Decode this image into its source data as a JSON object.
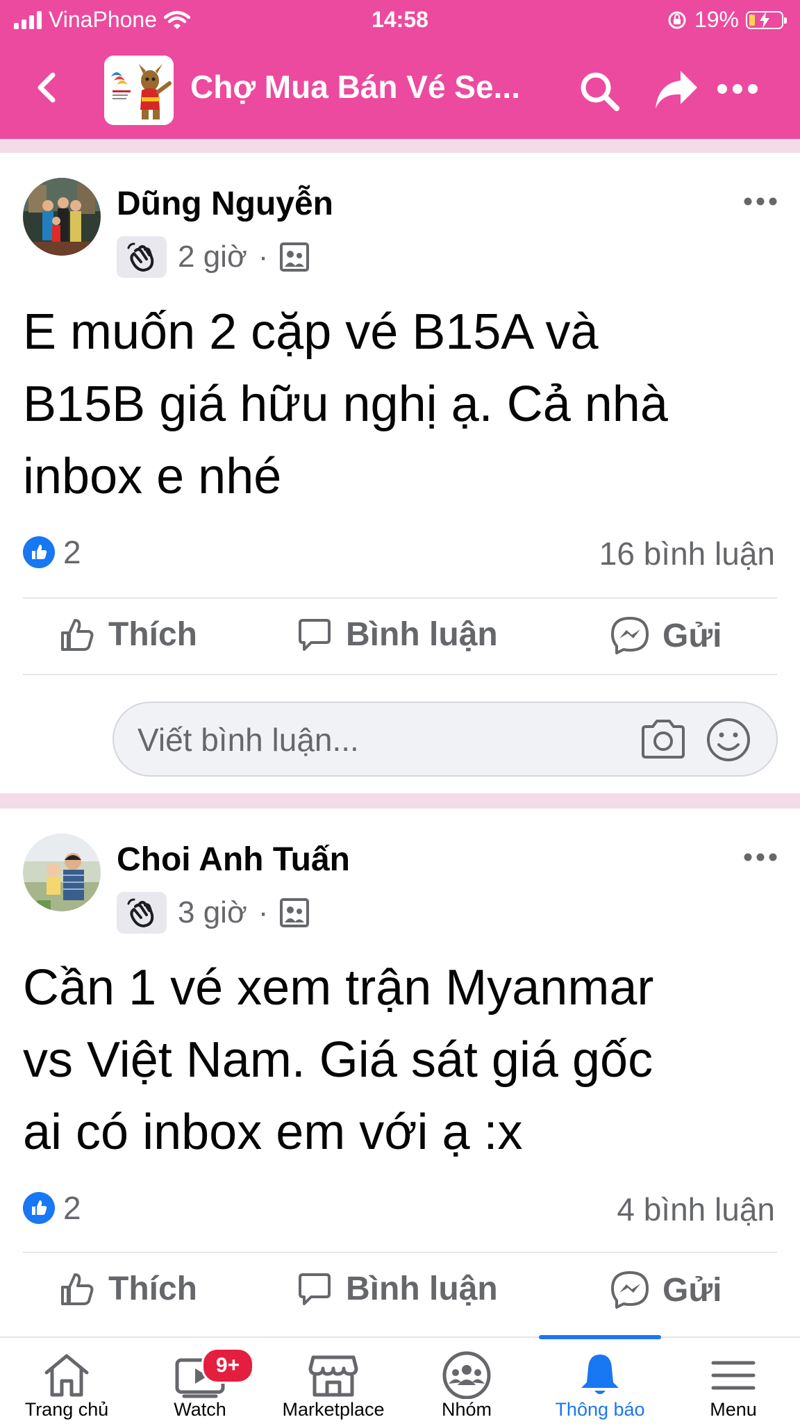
{
  "status_bar": {
    "carrier": "VinaPhone",
    "time": "14:58",
    "battery": "19%",
    "battery_level": 0.19
  },
  "header": {
    "title": "Chợ Mua Bán Vé Se...",
    "back_icon": "chevron-left-icon",
    "search_icon": "search-icon",
    "share_icon": "share-icon",
    "more_icon": "more-horizontal-icon"
  },
  "posts": [
    {
      "author": "Dũng Nguyễn",
      "time": "2 giờ",
      "separator": "·",
      "text": "E muốn 2 cặp vé B15A và\nB15B giá hữu nghị ạ. Cả nhà\ninbox e nhé",
      "likes": "2",
      "comments": "16 bình luận",
      "actions": {
        "like": "Thích",
        "comment": "Bình luận",
        "send": "Gửi"
      },
      "comment_placeholder": "Viết bình luận..."
    },
    {
      "author": "Choi Anh Tuấn",
      "time": "3 giờ",
      "separator": "·",
      "text": "Cần 1 vé xem trận Myanmar\nvs Việt Nam. Giá sát giá gốc\nai có inbox em với ạ :x",
      "likes": "2",
      "comments": "4 bình luận",
      "actions": {
        "like": "Thích",
        "comment": "Bình luận",
        "send": "Gửi"
      }
    }
  ],
  "bottom_nav": {
    "items": [
      {
        "label": "Trang chủ",
        "icon": "home-icon"
      },
      {
        "label": "Watch",
        "icon": "video-icon",
        "badge": "9+"
      },
      {
        "label": "Marketplace",
        "icon": "shop-icon"
      },
      {
        "label": "Nhóm",
        "icon": "groups-icon"
      },
      {
        "label": "Thông báo",
        "icon": "bell-icon",
        "active": true
      },
      {
        "label": "Menu",
        "icon": "menu-icon"
      }
    ]
  },
  "colors": {
    "header_bg": "#ec4a9f",
    "accent": "#1877f2",
    "badge": "#e41e3f",
    "secondary_text": "#65676b"
  }
}
